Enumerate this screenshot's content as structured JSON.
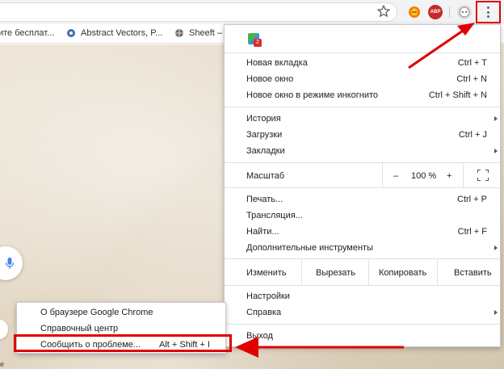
{
  "toolbar": {
    "abp_label": "ABP"
  },
  "bookmarks": [
    {
      "label": "ите бесплат..."
    },
    {
      "label": "Abstract Vectors, P..."
    },
    {
      "label": "Sheeft –"
    }
  ],
  "menu": {
    "badge_count": "2",
    "new_tab": {
      "label": "Новая вкладка",
      "shortcut": "Ctrl + T"
    },
    "new_window": {
      "label": "Новое окно",
      "shortcut": "Ctrl + N"
    },
    "incognito": {
      "label": "Новое окно в режиме инкогнито",
      "shortcut": "Ctrl + Shift + N"
    },
    "history": {
      "label": "История"
    },
    "downloads": {
      "label": "Загрузки",
      "shortcut": "Ctrl + J"
    },
    "bookmarks": {
      "label": "Закладки"
    },
    "zoom": {
      "label": "Масштаб",
      "minus": "–",
      "value": "100 %",
      "plus": "+"
    },
    "print": {
      "label": "Печать...",
      "shortcut": "Ctrl + P"
    },
    "cast": {
      "label": "Трансляция..."
    },
    "find": {
      "label": "Найти...",
      "shortcut": "Ctrl + F"
    },
    "more_tools": {
      "label": "Дополнительные инструменты"
    },
    "edit": {
      "label": "Изменить",
      "cut": "Вырезать",
      "copy": "Копировать",
      "paste": "Вставить"
    },
    "settings": {
      "label": "Настройки"
    },
    "help": {
      "label": "Справка"
    },
    "exit": {
      "label": "Выход"
    }
  },
  "help_menu": {
    "about": {
      "label": "О браузере Google Chrome"
    },
    "help_center": {
      "label": "Справочный центр"
    },
    "report": {
      "label": "Сообщить о проблеме...",
      "shortcut": "Alt + Shift + I"
    }
  },
  "page": {
    "corner_text": "е"
  },
  "colors": {
    "highlight": "#e00000",
    "abp": "#c72a2a"
  }
}
